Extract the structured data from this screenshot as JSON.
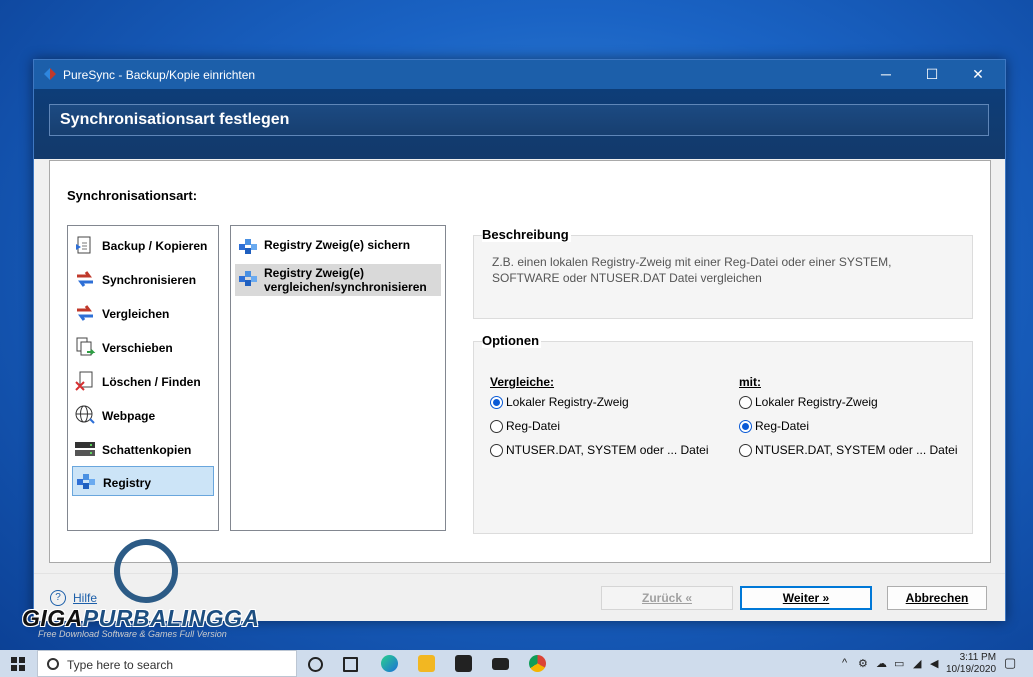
{
  "window": {
    "title": "PureSync - Backup/Kopie einrichten",
    "minimize_glyph": "─",
    "maximize_glyph": "☐",
    "close_glyph": "✕"
  },
  "banner": {
    "title": "Synchronisationsart festlegen"
  },
  "panel": {
    "sync_label": "Synchronisationsart:"
  },
  "sync_types": [
    {
      "label": "Backup / Kopieren",
      "icon": "backup-icon",
      "selected": false
    },
    {
      "label": "Synchronisieren",
      "icon": "sync-icon",
      "selected": false
    },
    {
      "label": "Vergleichen",
      "icon": "compare-icon",
      "selected": false
    },
    {
      "label": "Verschieben",
      "icon": "move-icon",
      "selected": false
    },
    {
      "label": "Löschen / Finden",
      "icon": "delete-find-icon",
      "selected": false
    },
    {
      "label": "Webpage",
      "icon": "webpage-icon",
      "selected": false
    },
    {
      "label": "Schattenkopien",
      "icon": "shadow-copy-icon",
      "selected": false
    },
    {
      "label": "Registry",
      "icon": "registry-icon",
      "selected": true
    }
  ],
  "registry_actions": [
    {
      "label": "Registry Zweig(e) sichern",
      "icon": "registry-icon",
      "selected": false
    },
    {
      "label": "Registry Zweig(e) vergleichen/synchronisieren",
      "label_line1": "Registry Zweig(e)",
      "label_line2": "vergleichen/synchronisieren",
      "icon": "registry-icon",
      "selected": true
    }
  ],
  "description": {
    "title": "Beschreibung",
    "text": "Z.B. einen lokalen Registry-Zweig mit einer Reg-Datei oder einer SYSTEM, SOFTWARE oder NTUSER.DAT Datei vergleichen"
  },
  "options": {
    "title": "Optionen",
    "compare_heading": "Vergleiche:",
    "with_heading": "mit:",
    "compare_choices": [
      {
        "label": "Lokaler Registry-Zweig",
        "checked": true
      },
      {
        "label": "Reg-Datei",
        "checked": false
      },
      {
        "label": "NTUSER.DAT, SYSTEM oder ... Datei",
        "checked": false
      }
    ],
    "with_choices": [
      {
        "label": "Lokaler Registry-Zweig",
        "checked": false
      },
      {
        "label": "Reg-Datei",
        "checked": true
      },
      {
        "label": "NTUSER.DAT, SYSTEM oder ... Datei",
        "checked": false
      }
    ]
  },
  "footer": {
    "help_label": "Hilfe",
    "back_label": "Zurück «",
    "next_label": "Weiter »",
    "cancel_label": "Abbrechen"
  },
  "watermark": {
    "brand": "GIGAPURBALINGGA",
    "brand_part1": "GIGA",
    "brand_part2": "PURBALINGGA",
    "tagline": "Free Download Software & Games Full Version"
  },
  "taskbar": {
    "search_placeholder": "Type here to search",
    "time": "3:11 PM",
    "date": "10/19/2020"
  },
  "colors": {
    "accent": "#1c5faa",
    "banner": "#173f70",
    "selection": "#cce4f7"
  }
}
